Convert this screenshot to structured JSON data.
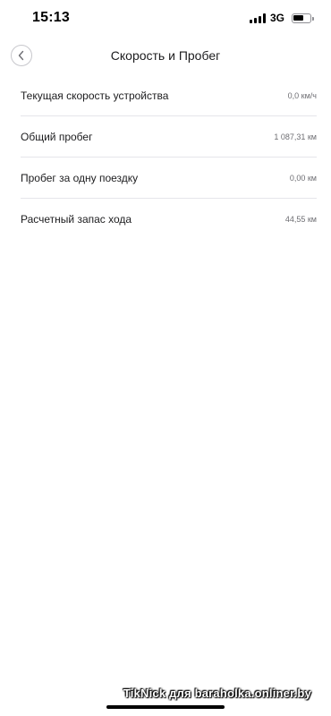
{
  "status_bar": {
    "time": "15:13",
    "network": "3G",
    "battery_level": 0.65
  },
  "header": {
    "title": "Скорость и Пробег"
  },
  "rows": [
    {
      "label": "Текущая скорость устройства",
      "value": "0,0 км/ч"
    },
    {
      "label": "Общий пробег",
      "value": "1 087,31 км"
    },
    {
      "label": "Пробег за одну поездку",
      "value": "0,00 км"
    },
    {
      "label": "Расчетный запас хода",
      "value": "44,55 км"
    }
  ],
  "watermark": {
    "text": "TikNick для baraholka.onliner.by"
  }
}
